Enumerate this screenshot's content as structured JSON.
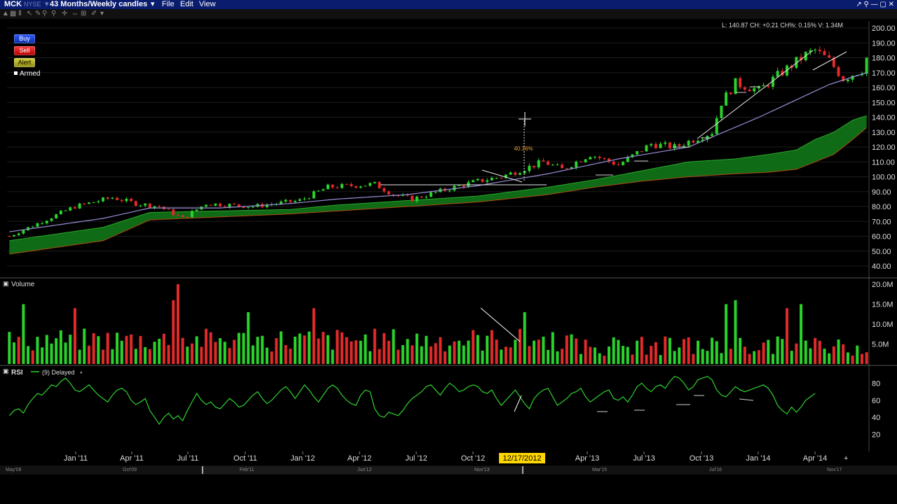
{
  "header": {
    "symbol": "MCK",
    "exchange": "NYSE",
    "period": "43 Months/Weekly candles",
    "menu_file": "File",
    "menu_edit": "Edit",
    "menu_view": "View"
  },
  "order_buttons": {
    "buy": "Buy",
    "sell": "Sell",
    "alert": "Alert",
    "armed": "Armed"
  },
  "ohlc_readout": "L: 140.87 CH: +0.21 CH%: 0.15% V: 1.34M",
  "colors": {
    "up_candle": "#2bd22b",
    "down_candle": "#e12a2a",
    "cloud_fill": "#0f6b16",
    "cloud_top": "#2ba82b",
    "cloud_bottom": "#b04a14",
    "ma_line": "#9a8fd8",
    "rsi_line": "#2fd12f",
    "highlight_date_bg": "#ffd700"
  },
  "panels": {
    "volume_label": "Volume",
    "rsi_label": "RSI",
    "rsi_legend": "(9) Delayed"
  },
  "annotation": {
    "pct_change": "40.36%"
  },
  "highlight_date": "12/17/2012",
  "timeline": {
    "labels": [
      "May'08",
      "Oct'09",
      "Feb'11",
      "Jun'12",
      "Nov'13",
      "Mar'15",
      "Jul'16",
      "Nov'17"
    ]
  },
  "chart_data": [
    {
      "type": "candlestick",
      "title": "MCK Weekly candles",
      "x_ticks": [
        "Jan '11",
        "Apr '11",
        "Jul '11",
        "Oct '11",
        "Jan '12",
        "Apr '12",
        "Jul '12",
        "Oct '12",
        "Jan '13",
        "Apr '13",
        "Jul '13",
        "Oct '13",
        "Jan '14",
        "Apr '14"
      ],
      "y_ticks": [
        "200.00",
        "190.00",
        "180.00",
        "170.00",
        "160.00",
        "150.00",
        "140.00",
        "130.00",
        "120.00",
        "110.00",
        "100.00",
        "90.00",
        "80.00",
        "70.00",
        "60.00",
        "50.00",
        "40.00"
      ],
      "ylim": [
        40,
        200
      ],
      "close_path": [
        [
          0,
          60
        ],
        [
          14,
          80
        ],
        [
          22,
          86
        ],
        [
          27,
          82
        ],
        [
          32,
          80
        ],
        [
          37,
          72
        ],
        [
          42,
          82
        ],
        [
          52,
          80
        ],
        [
          62,
          84
        ],
        [
          68,
          93
        ],
        [
          78,
          95
        ],
        [
          82,
          88
        ],
        [
          86,
          85
        ],
        [
          95,
          93
        ],
        [
          100,
          97
        ],
        [
          105,
          100
        ],
        [
          114,
          110
        ],
        [
          118,
          105
        ],
        [
          124,
          115
        ],
        [
          130,
          108
        ],
        [
          137,
          122
        ],
        [
          142,
          120
        ],
        [
          150,
          130
        ],
        [
          152,
          150
        ],
        [
          155,
          163
        ],
        [
          160,
          158
        ],
        [
          164,
          168
        ],
        [
          170,
          182
        ],
        [
          172,
          185
        ],
        [
          175,
          178
        ],
        [
          178,
          166
        ],
        [
          182,
          172
        ],
        [
          183,
          180
        ]
      ],
      "ma_line": [
        [
          0,
          63
        ],
        [
          20,
          72
        ],
        [
          30,
          79
        ],
        [
          45,
          79
        ],
        [
          60,
          82
        ],
        [
          70,
          85
        ],
        [
          85,
          88
        ],
        [
          100,
          94
        ],
        [
          115,
          102
        ],
        [
          130,
          112
        ],
        [
          145,
          120
        ],
        [
          160,
          140
        ],
        [
          175,
          162
        ],
        [
          183,
          170
        ]
      ],
      "cloud_top": [
        [
          0,
          57
        ],
        [
          20,
          66
        ],
        [
          30,
          76
        ],
        [
          45,
          77
        ],
        [
          60,
          78
        ],
        [
          70,
          81
        ],
        [
          85,
          84
        ],
        [
          100,
          87
        ],
        [
          115,
          93
        ],
        [
          125,
          98
        ],
        [
          135,
          104
        ],
        [
          145,
          110
        ],
        [
          155,
          112
        ],
        [
          162,
          115
        ],
        [
          168,
          118
        ],
        [
          172,
          125
        ],
        [
          176,
          130
        ],
        [
          180,
          138
        ],
        [
          183,
          141
        ]
      ],
      "cloud_bottom": [
        [
          0,
          48
        ],
        [
          20,
          57
        ],
        [
          30,
          71
        ],
        [
          45,
          73
        ],
        [
          60,
          75
        ],
        [
          70,
          77
        ],
        [
          85,
          80
        ],
        [
          100,
          83
        ],
        [
          115,
          88
        ],
        [
          125,
          93
        ],
        [
          135,
          97
        ],
        [
          145,
          100
        ],
        [
          155,
          102
        ],
        [
          162,
          103
        ],
        [
          168,
          105
        ],
        [
          172,
          110
        ],
        [
          176,
          115
        ],
        [
          180,
          125
        ],
        [
          183,
          133
        ]
      ]
    },
    {
      "type": "bar",
      "title": "Volume",
      "y_ticks": [
        "20.0M",
        "15.0M",
        "10.0M",
        "5.0M"
      ],
      "ylim": [
        0,
        20
      ],
      "unit": "M"
    },
    {
      "type": "line",
      "title": "RSI",
      "y_ticks": [
        "80",
        "60",
        "40",
        "20"
      ],
      "ylim": [
        10,
        90
      ],
      "values": [
        42,
        48,
        50,
        45,
        55,
        62,
        68,
        66,
        72,
        78,
        76,
        82,
        86,
        80,
        72,
        70,
        74,
        78,
        72,
        66,
        62,
        58,
        66,
        72,
        74,
        70,
        60,
        55,
        58,
        62,
        48,
        40,
        32,
        40,
        45,
        38,
        42,
        36,
        48,
        58,
        68,
        60,
        55,
        58,
        52,
        50,
        56,
        62,
        58,
        52,
        54,
        60,
        66,
        70,
        62,
        56,
        60,
        66,
        72,
        76,
        70,
        62,
        70,
        78,
        72,
        64,
        58,
        66,
        74,
        78,
        74,
        66,
        60,
        56,
        54,
        66,
        72,
        70,
        50,
        42,
        40,
        46,
        44,
        42,
        48,
        56,
        62,
        66,
        70,
        76,
        78,
        72,
        66,
        74,
        80,
        76,
        70,
        72,
        76,
        78,
        76,
        70,
        68,
        72,
        62,
        54,
        60,
        66,
        72,
        64,
        56,
        50,
        62,
        68,
        72,
        74,
        64,
        54,
        58,
        62,
        68,
        70,
        74,
        64,
        58,
        62,
        66,
        70,
        72,
        62,
        60,
        64,
        58,
        66,
        76,
        80,
        74,
        70,
        76,
        78,
        74,
        82,
        88,
        86,
        80,
        72,
        76,
        84,
        86,
        88,
        84,
        72,
        66,
        64,
        70,
        76,
        72,
        70,
        72,
        74,
        76,
        78,
        74,
        66,
        54,
        48,
        44,
        52,
        46,
        52,
        60,
        64,
        68
      ]
    }
  ]
}
